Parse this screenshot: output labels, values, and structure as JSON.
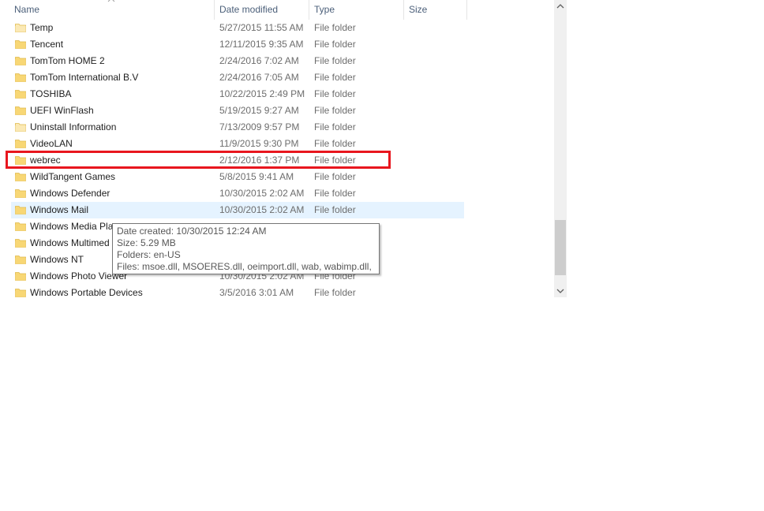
{
  "columns": {
    "name": "Name",
    "date_modified": "Date modified",
    "type": "Type",
    "size": "Size"
  },
  "sort_icon": "chevron-up-icon",
  "rows": [
    {
      "name": "Temp",
      "date": "5/27/2015 11:55 AM",
      "type": "File folder"
    },
    {
      "name": "Tencent",
      "date": "12/11/2015 9:35 AM",
      "type": "File folder"
    },
    {
      "name": "TomTom HOME 2",
      "date": "2/24/2016 7:02 AM",
      "type": "File folder"
    },
    {
      "name": "TomTom International B.V",
      "date": "2/24/2016 7:05 AM",
      "type": "File folder"
    },
    {
      "name": "TOSHIBA",
      "date": "10/22/2015 2:49 PM",
      "type": "File folder"
    },
    {
      "name": "UEFI WinFlash",
      "date": "5/19/2015 9:27 AM",
      "type": "File folder"
    },
    {
      "name": "Uninstall Information",
      "date": "7/13/2009 9:57 PM",
      "type": "File folder"
    },
    {
      "name": "VideoLAN",
      "date": "11/9/2015 9:30 PM",
      "type": "File folder"
    },
    {
      "name": "webrec",
      "date": "2/12/2016 1:37 PM",
      "type": "File folder"
    },
    {
      "name": "WildTangent Games",
      "date": "5/8/2015 9:41 AM",
      "type": "File folder"
    },
    {
      "name": "Windows Defender",
      "date": "10/30/2015 2:02 AM",
      "type": "File folder"
    },
    {
      "name": "Windows Mail",
      "date": "10/30/2015 2:02 AM",
      "type": "File folder"
    },
    {
      "name": "Windows Media Pla",
      "date": "",
      "type": ""
    },
    {
      "name": "Windows Multimed",
      "date": "",
      "type": ""
    },
    {
      "name": "Windows NT",
      "date": "",
      "type": ""
    },
    {
      "name": "Windows Photo Viewer",
      "date": "10/30/2015 2:02 AM",
      "type": "File folder"
    },
    {
      "name": "Windows Portable Devices",
      "date": "3/5/2016 3:01 AM",
      "type": "File folder"
    }
  ],
  "tooltip": {
    "date_created": "Date created: 10/30/2015 12:24 AM",
    "size": "Size: 5.29 MB",
    "folders": "Folders: en-US",
    "files": "Files: msoe.dll, MSOERES.dll, oeimport.dll, wab, wabimp.dll, ..."
  },
  "colors": {
    "highlight_border": "#e8161e",
    "folder_icon": "#f8d775",
    "hover_row": "#e5f3ff"
  }
}
